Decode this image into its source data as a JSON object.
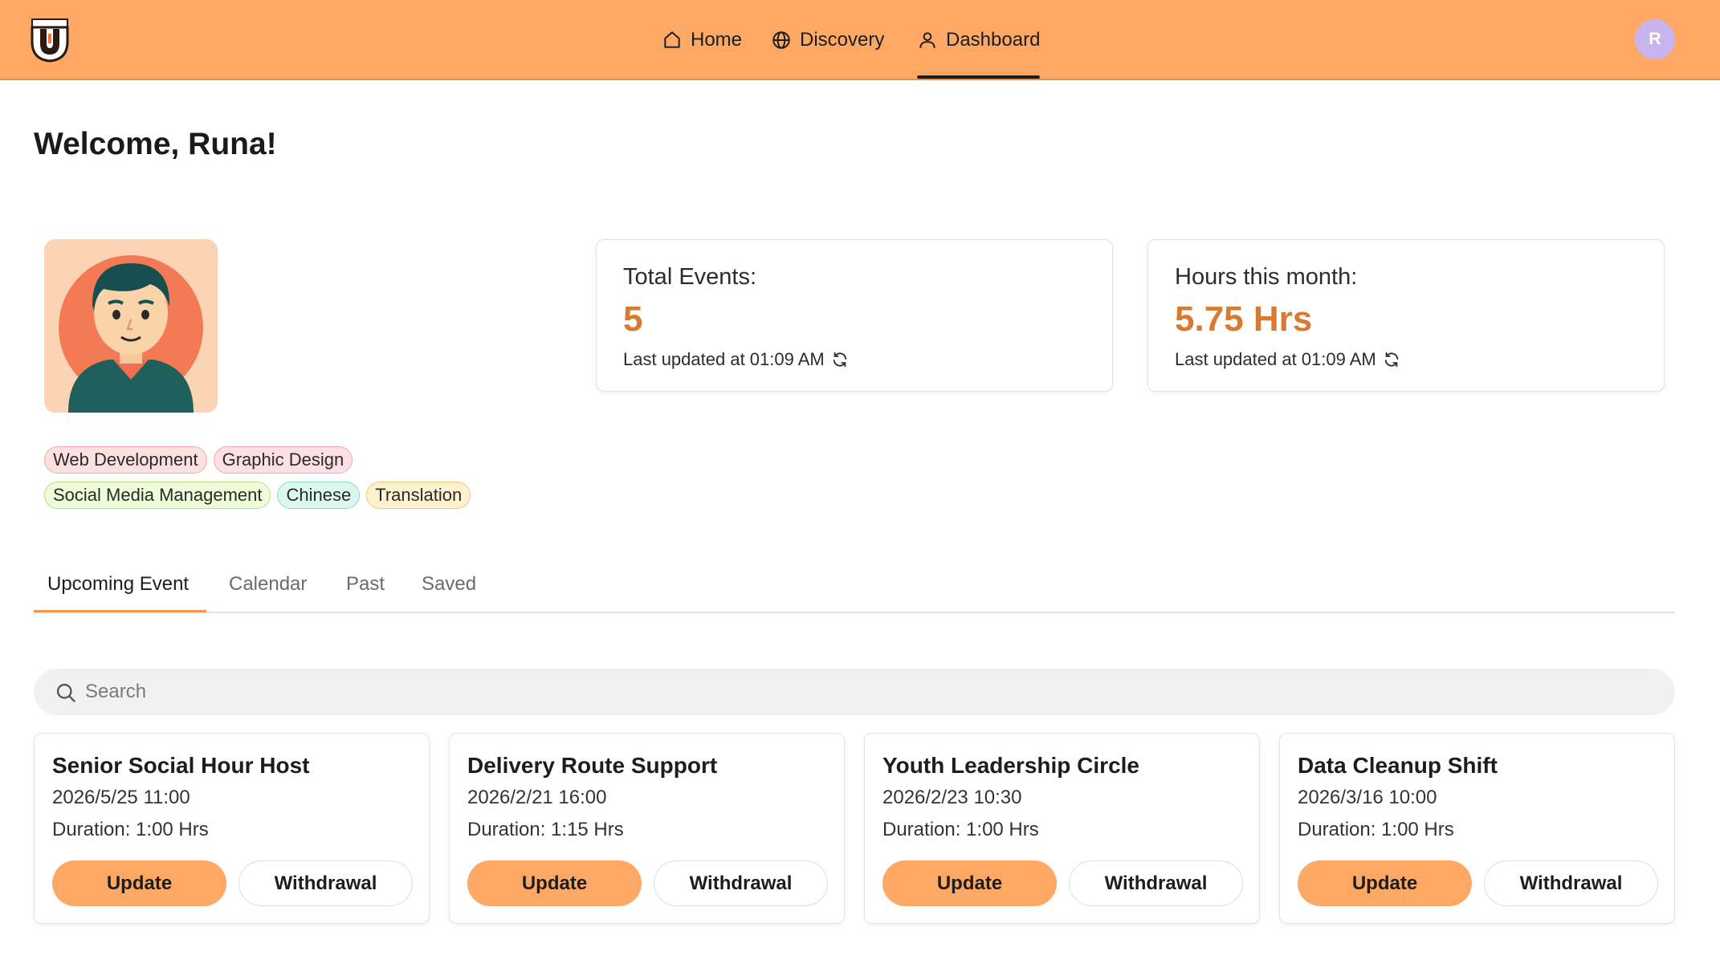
{
  "nav": {
    "home": "Home",
    "discovery": "Discovery",
    "dashboard": "Dashboard",
    "user_initial": "R"
  },
  "welcome": "Welcome, Runa!",
  "tags": [
    "Web Development",
    "Graphic Design",
    "Social Media Management",
    "Chinese",
    "Translation"
  ],
  "stats": {
    "events": {
      "label": "Total Events:",
      "value": "5",
      "updated": "Last updated at 01:09 AM"
    },
    "hours": {
      "label": "Hours this month:",
      "value": "5.75 Hrs",
      "updated": "Last updated at 01:09 AM"
    }
  },
  "tabs": [
    "Upcoming Event",
    "Calendar",
    "Past",
    "Saved"
  ],
  "search": {
    "placeholder": "Search"
  },
  "events": [
    {
      "title": "Senior Social Hour Host",
      "date": "2026/5/25 11:00",
      "duration": "Duration: 1:00 Hrs"
    },
    {
      "title": "Delivery Route Support",
      "date": "2026/2/21 16:00",
      "duration": "Duration: 1:15 Hrs"
    },
    {
      "title": "Youth Leadership Circle",
      "date": "2026/2/23 10:30",
      "duration": "Duration: 1:00 Hrs"
    },
    {
      "title": "Data Cleanup Shift",
      "date": "2026/3/16 10:00",
      "duration": "Duration: 1:00 Hrs"
    }
  ],
  "buttons": {
    "update": "Update",
    "withdraw": "Withdrawal"
  },
  "colors": {
    "header": "#fda865",
    "accent": "#d97a30",
    "avatar": "#c9b4ee"
  }
}
